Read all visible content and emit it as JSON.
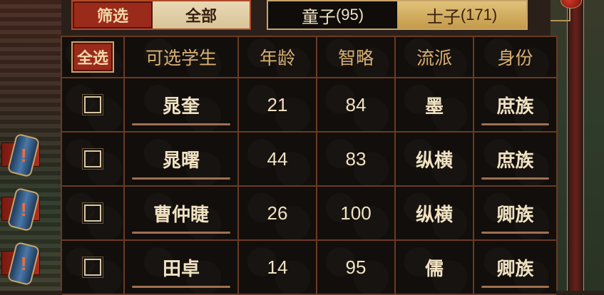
{
  "filter": {
    "label": "筛选",
    "value": "全部"
  },
  "tabs": [
    {
      "label": "童子",
      "count": "(95)",
      "active": false
    },
    {
      "label": "士子",
      "count": "(171)",
      "active": true
    }
  ],
  "table": {
    "select_all": "全选",
    "headers": [
      "可选学生",
      "年龄",
      "智略",
      "流派",
      "身份"
    ],
    "rows": [
      {
        "name": "晁奎",
        "age": "21",
        "wisdom": "84",
        "school": "墨",
        "status": "庶族"
      },
      {
        "name": "晁曙",
        "age": "44",
        "wisdom": "83",
        "school": "纵横",
        "status": "庶族"
      },
      {
        "name": "曹仲睫",
        "age": "26",
        "wisdom": "100",
        "school": "纵横",
        "status": "卿族"
      },
      {
        "name": "田卓",
        "age": "14",
        "wisdom": "95",
        "school": "儒",
        "status": "卿族"
      }
    ]
  },
  "alerts": [
    {
      "icon": "exclamation-icon"
    },
    {
      "icon": "exclamation-icon"
    },
    {
      "icon": "exclamation-icon"
    }
  ],
  "colors": {
    "accent_red": "#9a2a1a",
    "gold": "#c8a46a",
    "text_gold": "#d8b072"
  }
}
